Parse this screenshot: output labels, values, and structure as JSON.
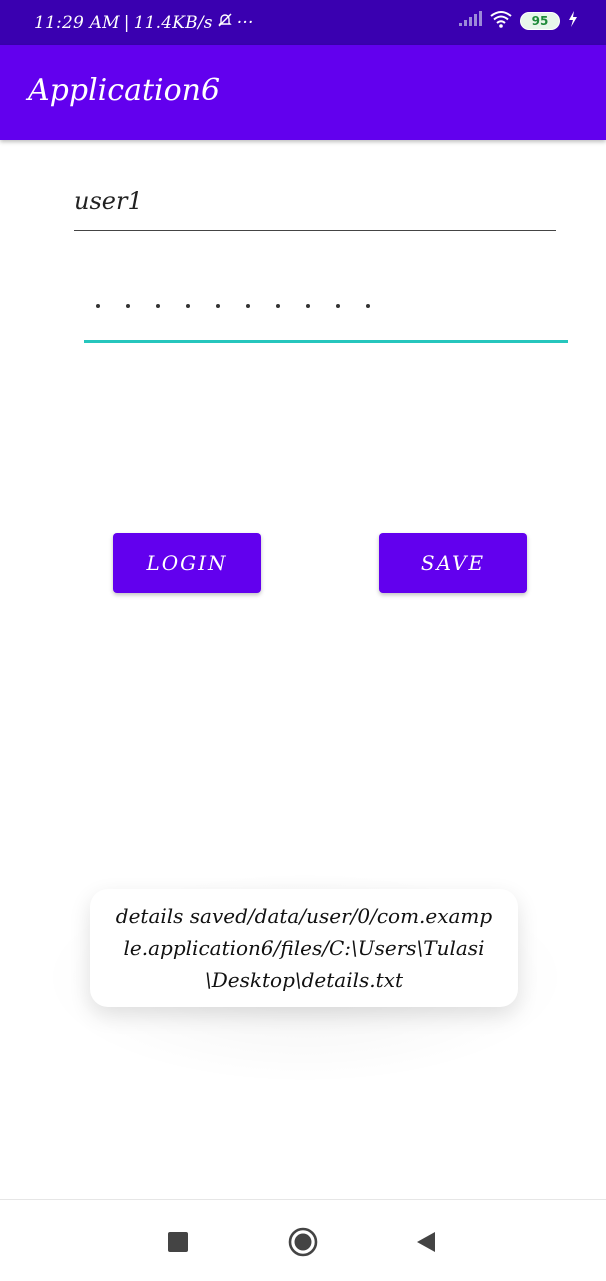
{
  "status_bar": {
    "time": "11:29 AM",
    "separator": "|",
    "net_speed": "11.4KB/s",
    "more": "···",
    "battery": "95",
    "icons": [
      "muted-bell-icon",
      "signal-icon",
      "wifi-icon",
      "battery-icon",
      "charging-icon"
    ]
  },
  "app_bar": {
    "title": "Application6"
  },
  "form": {
    "username_value": "user1",
    "password_masked_length": 10
  },
  "buttons": {
    "login_label": "LOGIN",
    "save_label": "SAVE"
  },
  "toast": {
    "message": "details saved/data/user/0/com.example.application6/files/C:\\Users\\Tulasi\\Desktop\\details.txt"
  },
  "colors": {
    "status_bar": "#3a00b0",
    "primary": "#6200ee",
    "accent": "#26c6bd"
  },
  "nav_bar": {
    "icons": [
      "recents-icon",
      "home-icon",
      "back-icon"
    ]
  }
}
